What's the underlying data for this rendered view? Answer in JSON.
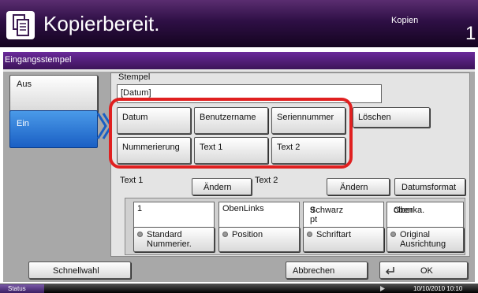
{
  "header": {
    "title": "Kopierbereit.",
    "copies_label": "Kopien",
    "copies_value": "1",
    "icon": "copy-mode-icon",
    "accent_color": "#2e0f45"
  },
  "panel": {
    "title": "Eingangsstempel",
    "left_buttons": {
      "aus": "Aus",
      "ein": "Ein"
    },
    "stempel_label": "Stempel",
    "stempel_value": "[Datum]",
    "insert_buttons": {
      "datum": "Datum",
      "benutzername": "Benutzername",
      "seriennummer": "Seriennummer",
      "loeschen": "Löschen",
      "nummerierung": "Nummerierung",
      "text1": "Text 1",
      "text2": "Text 2"
    },
    "text1_label": "Text 1",
    "text2_label": "Text 2",
    "aendern": "Ändern",
    "datumsformat": "Datumsformat",
    "settings": [
      {
        "value_line1": "1",
        "value_line2": "",
        "button_line1": "Standard",
        "button_line2": "Nummerier."
      },
      {
        "value_line1": "ObenLinks",
        "value_line2": "",
        "button_line1": "Position",
        "button_line2": ""
      },
      {
        "value_line1": "9 pt",
        "value_line2": "Schwarz",
        "button_line1": "Schriftart",
        "button_line2": ""
      },
      {
        "value_line1": "Oberka.",
        "value_line2": "oben",
        "button_line1": "Original",
        "button_line2": "Ausrichtung"
      }
    ],
    "highlight_color": "#e02020"
  },
  "footer": {
    "schnellwahl": "Schnellwahl",
    "abbrechen": "Abbrechen",
    "ok": "OK"
  },
  "statusbar": {
    "status": "Status",
    "datetime": "10/10/2010 10:10"
  }
}
